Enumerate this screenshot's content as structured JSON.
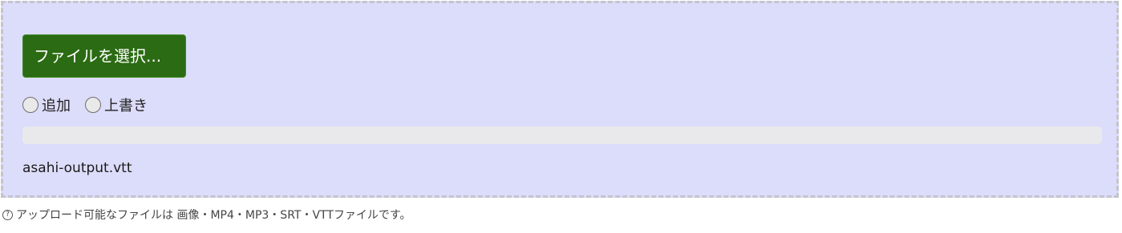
{
  "upload": {
    "button_label": "ファイルを選択...",
    "modes": [
      {
        "label": "追加",
        "selected": false
      },
      {
        "label": "上書き",
        "selected": false
      }
    ],
    "progress": 0,
    "file_name": "asahi-output.vtt"
  },
  "hint": {
    "icon": "help-circle-icon",
    "icon_glyph": "?",
    "text": "アップロード可能なファイルは 画像・MP4・MP3・SRT・VTTファイルです。"
  },
  "colors": {
    "dropzone_bg": "#dcdcfb",
    "button_bg": "#2b6b13",
    "track_bg": "#e9e9ec"
  }
}
